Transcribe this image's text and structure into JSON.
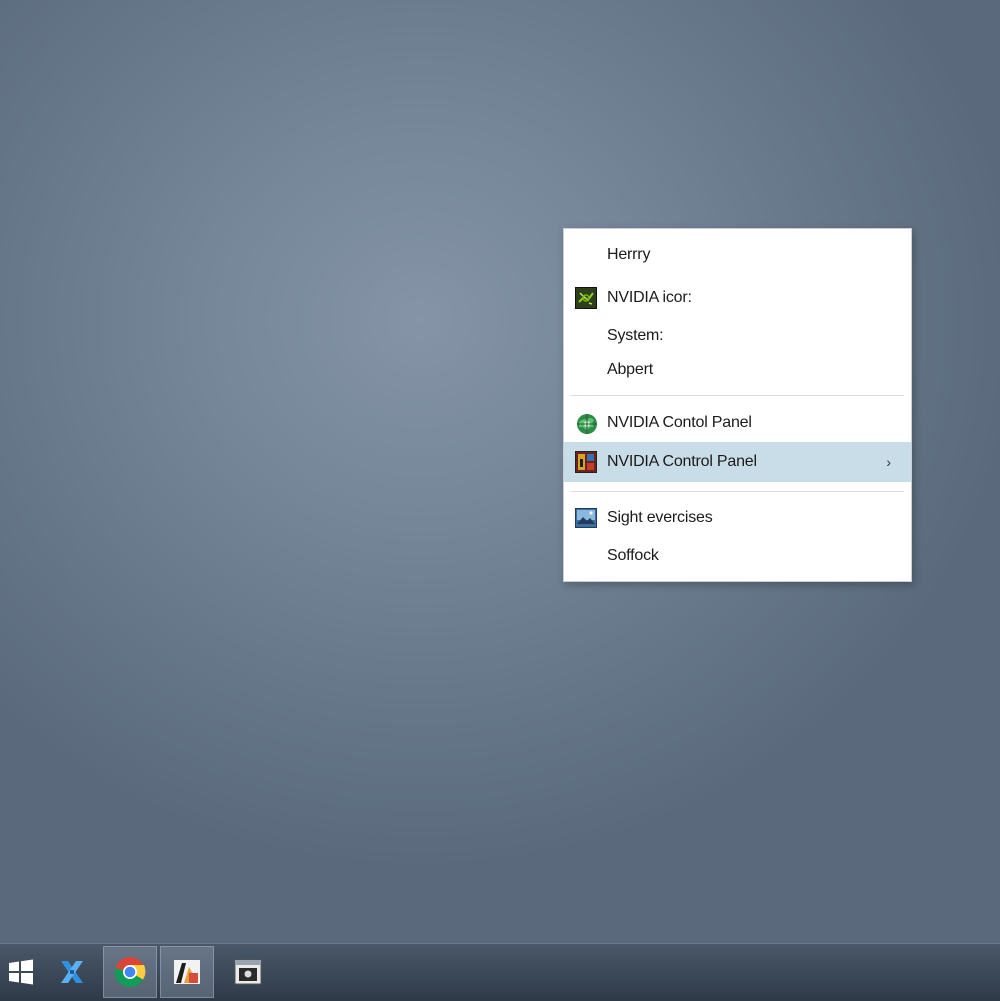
{
  "context_menu": {
    "items": [
      {
        "label": "Herrry",
        "icon": null
      },
      {
        "label": "NVIDIA icor:",
        "icon": "nvidia-logo-icon"
      },
      {
        "label": "System:",
        "icon": null
      },
      {
        "label": "Abpert",
        "icon": null
      },
      {
        "label": "NVIDIA Contol Panel",
        "icon": "nvidia-globe-icon"
      },
      {
        "label": "NVIDIA Control Panel",
        "icon": "nvidia-control-panel-icon",
        "highlighted": true,
        "submenu_arrow": "›"
      },
      {
        "label": "Sight evercises",
        "icon": "picture-icon"
      },
      {
        "label": "Soffock",
        "icon": null
      }
    ],
    "highlight_color": "#c9dde8"
  },
  "taskbar": {
    "buttons": [
      {
        "name": "start-button",
        "icon": "windows-logo-icon"
      },
      {
        "name": "pinned-app-blue-x",
        "icon": "blue-x-icon"
      },
      {
        "name": "chrome-button",
        "icon": "chrome-icon",
        "active": true
      },
      {
        "name": "image-app-button",
        "icon": "image-app-icon",
        "active": true
      },
      {
        "name": "window-app-button",
        "icon": "window-app-icon"
      }
    ]
  }
}
